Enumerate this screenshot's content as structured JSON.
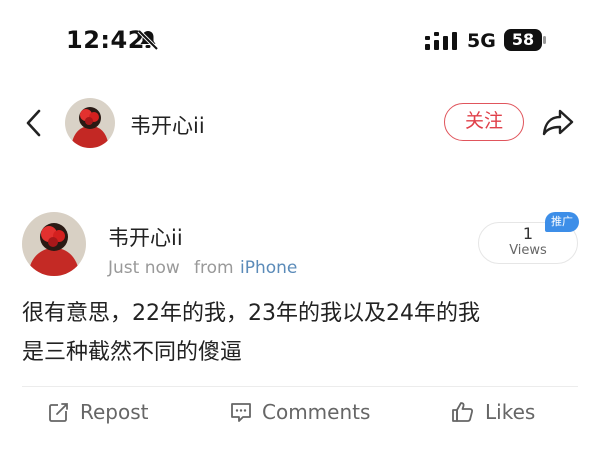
{
  "status_bar": {
    "time": "12:42",
    "network": "5G",
    "battery": "58",
    "icons": [
      "bell-muted-icon",
      "signal-icon",
      "battery-icon"
    ]
  },
  "nav": {
    "username": "韦开心ii",
    "follow_label": "关注",
    "icons": [
      "chevron-left-icon",
      "share-icon"
    ]
  },
  "post": {
    "author": "韦开心ii",
    "time": "Just now",
    "source_prefix": "from",
    "source_app": "iPhone",
    "views_count": "1",
    "views_label": "Views",
    "promo_tag": "推广",
    "text_line1": "很有意思，22年的我，23年的我以及24年的我",
    "text_line2": "是三种截然不同的傻逼"
  },
  "actions": {
    "repost": "Repost",
    "comments": "Comments",
    "likes": "Likes",
    "icons": [
      "repost-icon",
      "comment-icon",
      "thumbs-up-icon"
    ]
  },
  "colors": {
    "accent_red": "#e0404a",
    "link_blue": "#5b8bb9",
    "promo_blue": "#3d8ee8"
  }
}
